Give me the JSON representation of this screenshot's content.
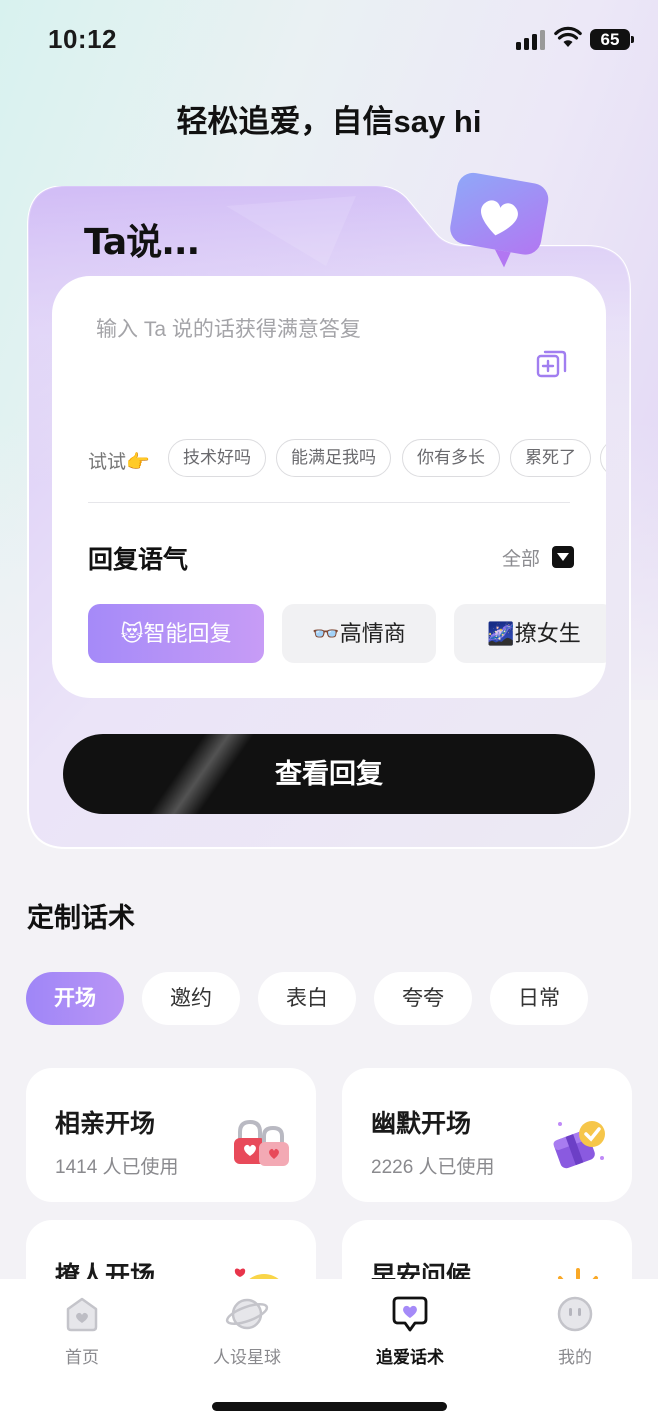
{
  "status_bar": {
    "time": "10:12",
    "battery": "65"
  },
  "headline": "轻松追爱，自信say hi",
  "reply_card": {
    "brand_title": "Ta说...",
    "input_placeholder": "输入 Ta 说的话获得满意答复",
    "try_label": "试试👉",
    "suggestions": [
      "技术好吗",
      "能满足我吗",
      "你有多长",
      "累死了"
    ],
    "tone_section_title": "回复语气",
    "all_label": "全部",
    "tones": [
      {
        "emoji": "😻",
        "label": "智能回复",
        "active": true
      },
      {
        "emoji": "👓",
        "label": "高情商",
        "active": false
      },
      {
        "emoji": "🌌",
        "label": "撩女生",
        "active": false
      }
    ],
    "submit_label": "查看回复"
  },
  "custom_scripts": {
    "title": "定制话术",
    "tabs": [
      {
        "label": "开场",
        "active": true
      },
      {
        "label": "邀约",
        "active": false
      },
      {
        "label": "表白",
        "active": false
      },
      {
        "label": "夸夸",
        "active": false
      },
      {
        "label": "日常",
        "active": false
      }
    ],
    "tiles": [
      {
        "title": "相亲开场",
        "usage": "1414 人已使用",
        "icon": "heart-padlocks-icon"
      },
      {
        "title": "幽默开场",
        "usage": "2226 人已使用",
        "icon": "purple-gift-badge-icon"
      },
      {
        "title": "撩人开场",
        "usage": "",
        "icon": "blushing-emoji-icon"
      },
      {
        "title": "早安问候",
        "usage": "",
        "icon": "sun-icon"
      }
    ]
  },
  "bottom_nav": [
    {
      "label": "首页",
      "icon": "home-heart-icon",
      "active": false
    },
    {
      "label": "人设星球",
      "icon": "planet-icon",
      "active": false
    },
    {
      "label": "追爱话术",
      "icon": "chat-heart-icon",
      "active": true
    },
    {
      "label": "我的",
      "icon": "smiley-face-icon",
      "active": false
    }
  ],
  "colors": {
    "accent_purple": "#a58af8",
    "submit_button": "#111111",
    "background": "#f3f2f6"
  }
}
